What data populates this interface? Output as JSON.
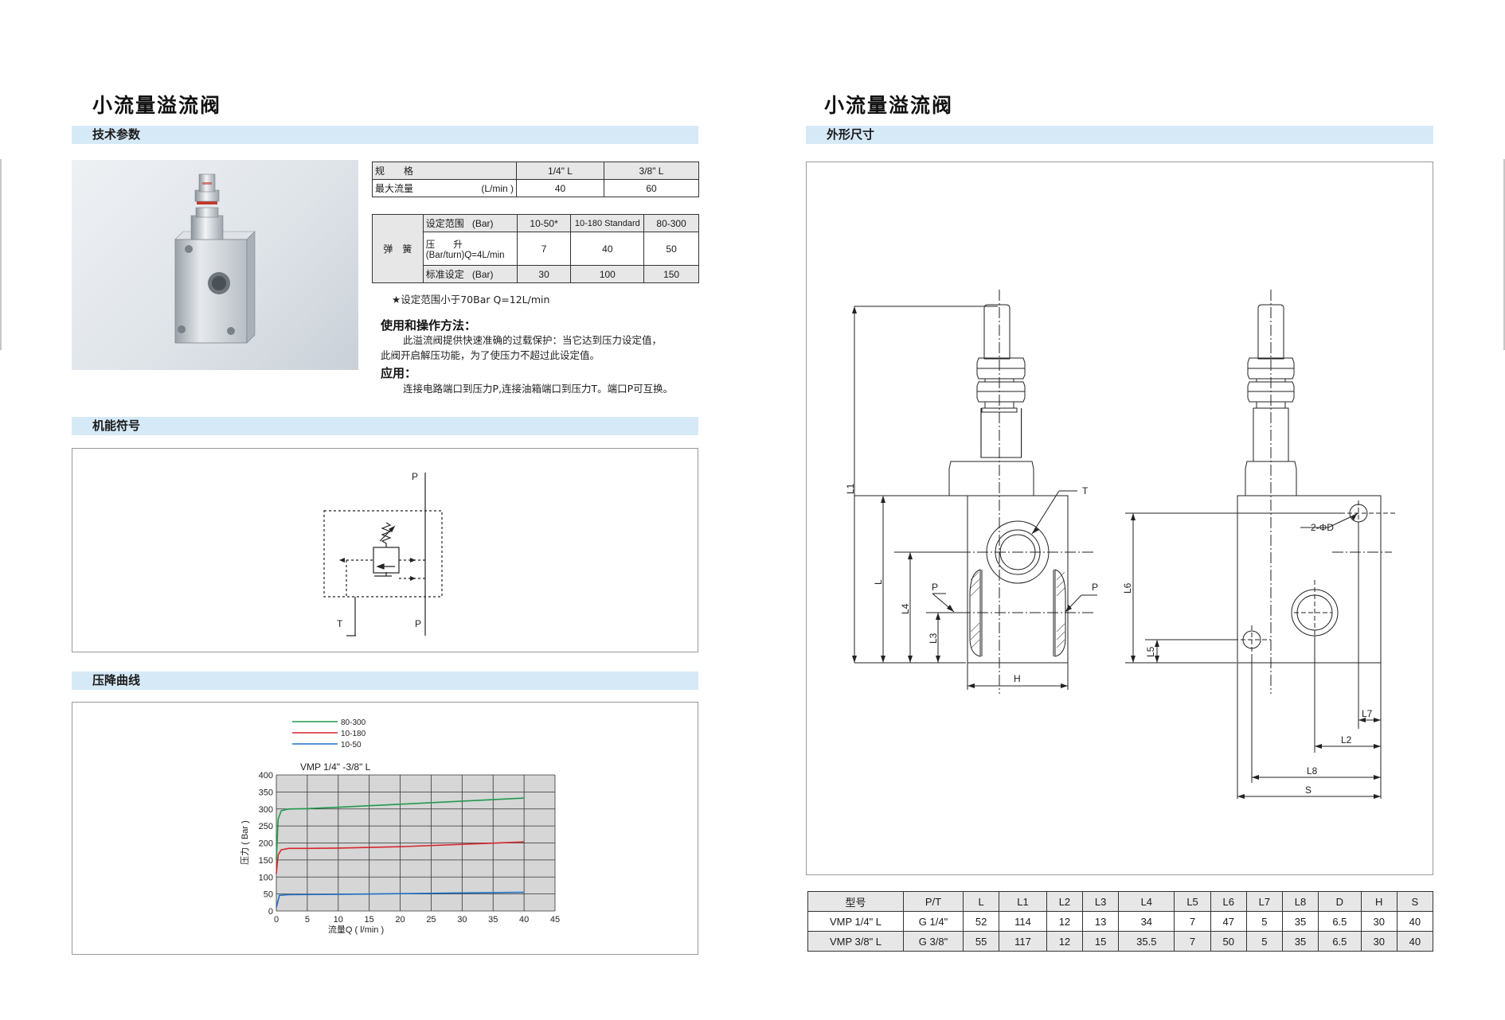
{
  "left": {
    "title": "小流量溢流阀",
    "sections": {
      "tech": "技术参数",
      "symbol": "机能符号",
      "curve": "压降曲线"
    },
    "spec_table": {
      "row1": [
        "规　　格",
        "1/4\" L",
        "3/8\" L"
      ],
      "row2": [
        "最大流量",
        "(L/min )",
        "40",
        "60"
      ]
    },
    "spring_table": {
      "group_label": "弹　簧",
      "rows": [
        {
          "label": "设定范围",
          "unit": "(Bar)",
          "values": [
            "10-50*",
            "10-180 Standard",
            "80-300"
          ]
        },
        {
          "label": "压　　升",
          "unit": "(Bar/turn)Q=4L/min",
          "values": [
            "7",
            "40",
            "50"
          ]
        },
        {
          "label": "标准设定",
          "unit": "(Bar)",
          "values": [
            "30",
            "100",
            "150"
          ]
        }
      ]
    },
    "footnote": "★设定范围小于70Bar Q=12L/min",
    "usage_title": "使用和操作方法：",
    "usage_text": [
      "此溢流阀提供快速准确的过载保护：当它达到压力设定值，",
      "此阀开启解压功能，为了使压力不超过此设定值。"
    ],
    "apply_title": "应用：",
    "apply_text": "连接电路端口到压力P,连接油箱端口到压力T。端口P可互换。",
    "symbol_labels": {
      "p_top": "P",
      "p_bottom": "P",
      "t": "T"
    }
  },
  "chart_data": {
    "type": "line",
    "title": "VMP 1/4\" -3/8\" L",
    "xlabel": "流量Q ( l/min )",
    "ylabel": "压力 ( Bar )",
    "xlim": [
      0,
      45
    ],
    "ylim": [
      0,
      400
    ],
    "x_ticks": [
      "0",
      "5",
      "10",
      "15",
      "20",
      "25",
      "30",
      "35",
      "40",
      "45"
    ],
    "y_ticks": [
      "0",
      "50",
      "100",
      "150",
      "200",
      "250",
      "300",
      "350",
      "400"
    ],
    "grid": true,
    "legend_position": "top",
    "series": [
      {
        "name": "80-300",
        "color": "#1f9a4e",
        "x": [
          0,
          0.3,
          0.8,
          2,
          5,
          10,
          20,
          30,
          40
        ],
        "y": [
          150,
          270,
          295,
          300,
          301,
          305,
          314,
          323,
          332
        ]
      },
      {
        "name": "10-180",
        "color": "#d6282d",
        "x": [
          0,
          0.3,
          0.8,
          2,
          5,
          10,
          20,
          30,
          40
        ],
        "y": [
          110,
          165,
          180,
          184,
          184,
          185,
          189,
          196,
          203
        ]
      },
      {
        "name": "10-50",
        "color": "#1f6fc4",
        "x": [
          0,
          0.5,
          2,
          10,
          20,
          30,
          40
        ],
        "y": [
          10,
          46,
          48,
          49,
          51,
          53,
          55
        ]
      }
    ]
  },
  "right": {
    "title": "小流量溢流阀",
    "section": "外形尺寸",
    "drawing_labels": {
      "L1": "L1",
      "L": "L",
      "L4": "L4",
      "L3": "L3",
      "H": "H",
      "T": "T",
      "P_left": "P",
      "P_right": "P",
      "phiD": "2-ΦD",
      "L6": "L6",
      "L5": "L5",
      "L7": "L7",
      "L2": "L2",
      "L8": "L8",
      "S": "S"
    },
    "dims_table": {
      "headers": [
        "型号",
        "P/T",
        "L",
        "L1",
        "L2",
        "L3",
        "L4",
        "L5",
        "L6",
        "L7",
        "L8",
        "D",
        "H",
        "S"
      ],
      "rows": [
        [
          "VMP 1/4\" L",
          "G 1/4\"",
          "52",
          "114",
          "12",
          "13",
          "34",
          "7",
          "47",
          "5",
          "35",
          "6.5",
          "30",
          "40"
        ],
        [
          "VMP 3/8\" L",
          "G 3/8\"",
          "55",
          "117",
          "12",
          "15",
          "35.5",
          "7",
          "50",
          "5",
          "35",
          "6.5",
          "30",
          "40"
        ]
      ]
    }
  }
}
